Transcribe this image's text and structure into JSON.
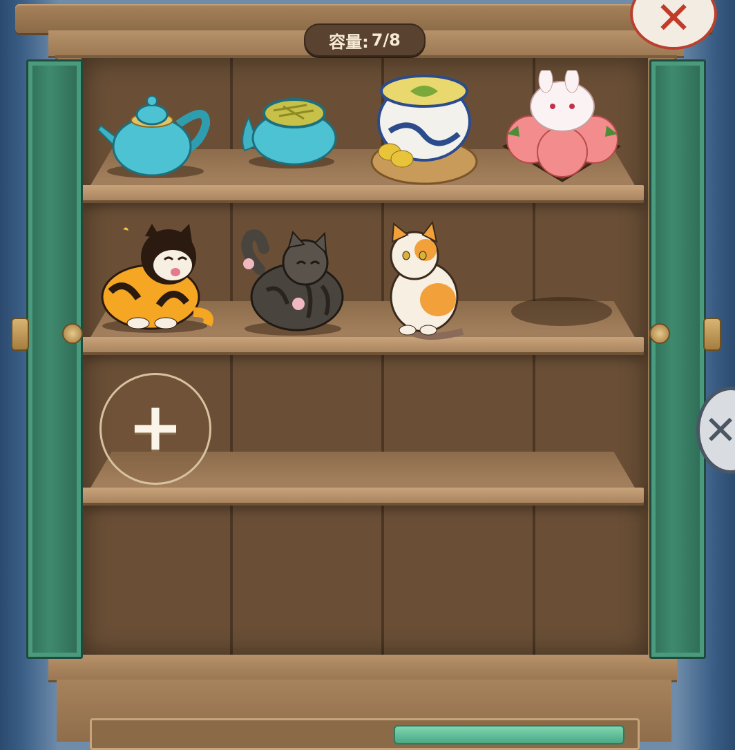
{
  "capacity": {
    "label": "容量:",
    "value": "7/8"
  },
  "buttons": {
    "close_glyph": "✕",
    "add_glyph": "+",
    "side_close_glyph": "✕"
  },
  "shelves": [
    {
      "items": [
        "teapot",
        "tea-leaf-jar",
        "blue-white-tea-bowl",
        "rabbit-peach-buns"
      ]
    },
    {
      "items": [
        "calico-cat-laughing",
        "tabby-cat-rolling",
        "calico-cat-sitting",
        "empty-slot"
      ]
    },
    {
      "items": [
        "add-slot"
      ]
    },
    {
      "items": []
    }
  ],
  "colors": {
    "door": "#3f8a6f",
    "wood": "#a98560",
    "close_accent": "#c23a28"
  }
}
